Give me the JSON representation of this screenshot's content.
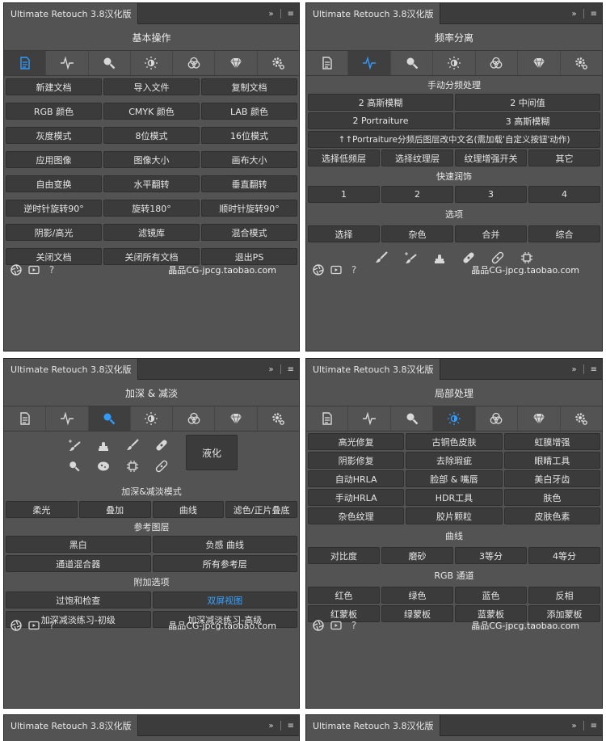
{
  "app_title": "Ultimate Retouch 3.8汉化版",
  "titlebar_icons": {
    "expand": "»",
    "menu": "≡"
  },
  "footer": {
    "url": "晶品CG-jpcg.taobao.com",
    "icons": [
      "aperture-icon",
      "video-icon",
      "help-icon"
    ],
    "help": "?"
  },
  "tabs": [
    "document-icon",
    "frequency-icon",
    "magnifier-icon",
    "brightness-icon",
    "color-circles-icon",
    "diamond-icon",
    "gear-icon"
  ],
  "panels": [
    {
      "title": "基本操作",
      "active_tab": 0,
      "rows": [
        [
          "新建文档",
          "导入文件",
          "复制文档"
        ],
        [
          "RGB 颜色",
          "CMYK 颜色",
          "LAB 颜色"
        ],
        [
          "灰度模式",
          "8位模式",
          "16位模式"
        ],
        [
          "应用图像",
          "图像大小",
          "画布大小"
        ],
        [
          "自由变换",
          "水平翻转",
          "垂直翻转"
        ],
        [
          "逆时针旋转90°",
          "旋转180°",
          "顺时针旋转90°"
        ],
        [
          "阴影/高光",
          "滤镜库",
          "混合模式"
        ],
        [
          "关闭文档",
          "关闭所有文档",
          "退出PS"
        ]
      ]
    },
    {
      "title": "频率分离",
      "active_tab": 1,
      "section1": "手动分频处理",
      "rows2": [
        [
          "2 高斯模糊",
          "2 中间值"
        ],
        [
          "2 Portraiture",
          "3 高斯模糊"
        ]
      ],
      "wide_button": "↑↑Portraiture分频后图层改中文名(需加载'自定义按钮'动作)",
      "rows4": [
        "选择低频层",
        "选择纹理层",
        "纹理增强开关",
        "其它"
      ],
      "section2": "快速润饰",
      "quick": [
        "1",
        "2",
        "3",
        "4"
      ],
      "section3": "选项",
      "options": [
        "选择",
        "杂色",
        "合并",
        "综合"
      ],
      "tools": [
        "brush-icon",
        "brush-sparkle-icon",
        "stamp-icon",
        "bandage-icon",
        "bandage2-icon",
        "chip-icon"
      ]
    },
    {
      "title": "加深 & 减淡",
      "active_tab": 2,
      "tools_row1": [
        "brush-sparkle-icon",
        "stamp-icon",
        "brush-icon",
        "bandage-icon"
      ],
      "tools_row2": [
        "magnifier-icon",
        "sponge-icon",
        "chip-icon",
        "bandage2-icon"
      ],
      "liquify": "液化",
      "section1": "加深&减淡模式",
      "modes": [
        "柔光",
        "叠加",
        "曲线",
        "滤色/正片叠底"
      ],
      "section2": "参考图层",
      "refs": [
        [
          "黑白",
          "负感 曲线"
        ],
        [
          "通道混合器",
          "所有参考层"
        ]
      ],
      "section3": "附加选项",
      "extra": [
        [
          "过饱和检查",
          "双屏视图"
        ],
        [
          "加深减淡练习-初级",
          "加深减淡练习-高级"
        ]
      ]
    },
    {
      "title": "局部处理",
      "active_tab": 3,
      "rows": [
        [
          "高光修复",
          "古铜色皮肤",
          "虹膜增强"
        ],
        [
          "阴影修复",
          "去除瑕疵",
          "眼睛工具"
        ],
        [
          "自动HRLA",
          "脸部 & 嘴唇",
          "美白牙齿"
        ],
        [
          "手动HRLA",
          "HDR工具",
          "肤色"
        ],
        [
          "杂色纹理",
          "胶片颗粒",
          "皮肤色素"
        ]
      ],
      "section1": "曲线",
      "curves": [
        "对比度",
        "磨砂",
        "3等分",
        "4等分"
      ],
      "section2": "RGB 通道",
      "rgb": [
        [
          "红色",
          "绿色",
          "蓝色",
          "反相"
        ],
        [
          "红蒙板",
          "绿蒙板",
          "蓝蒙板",
          "添加蒙板"
        ]
      ]
    }
  ],
  "bottom_panels_title": "Ultimate Retouch 3.8汉化版"
}
